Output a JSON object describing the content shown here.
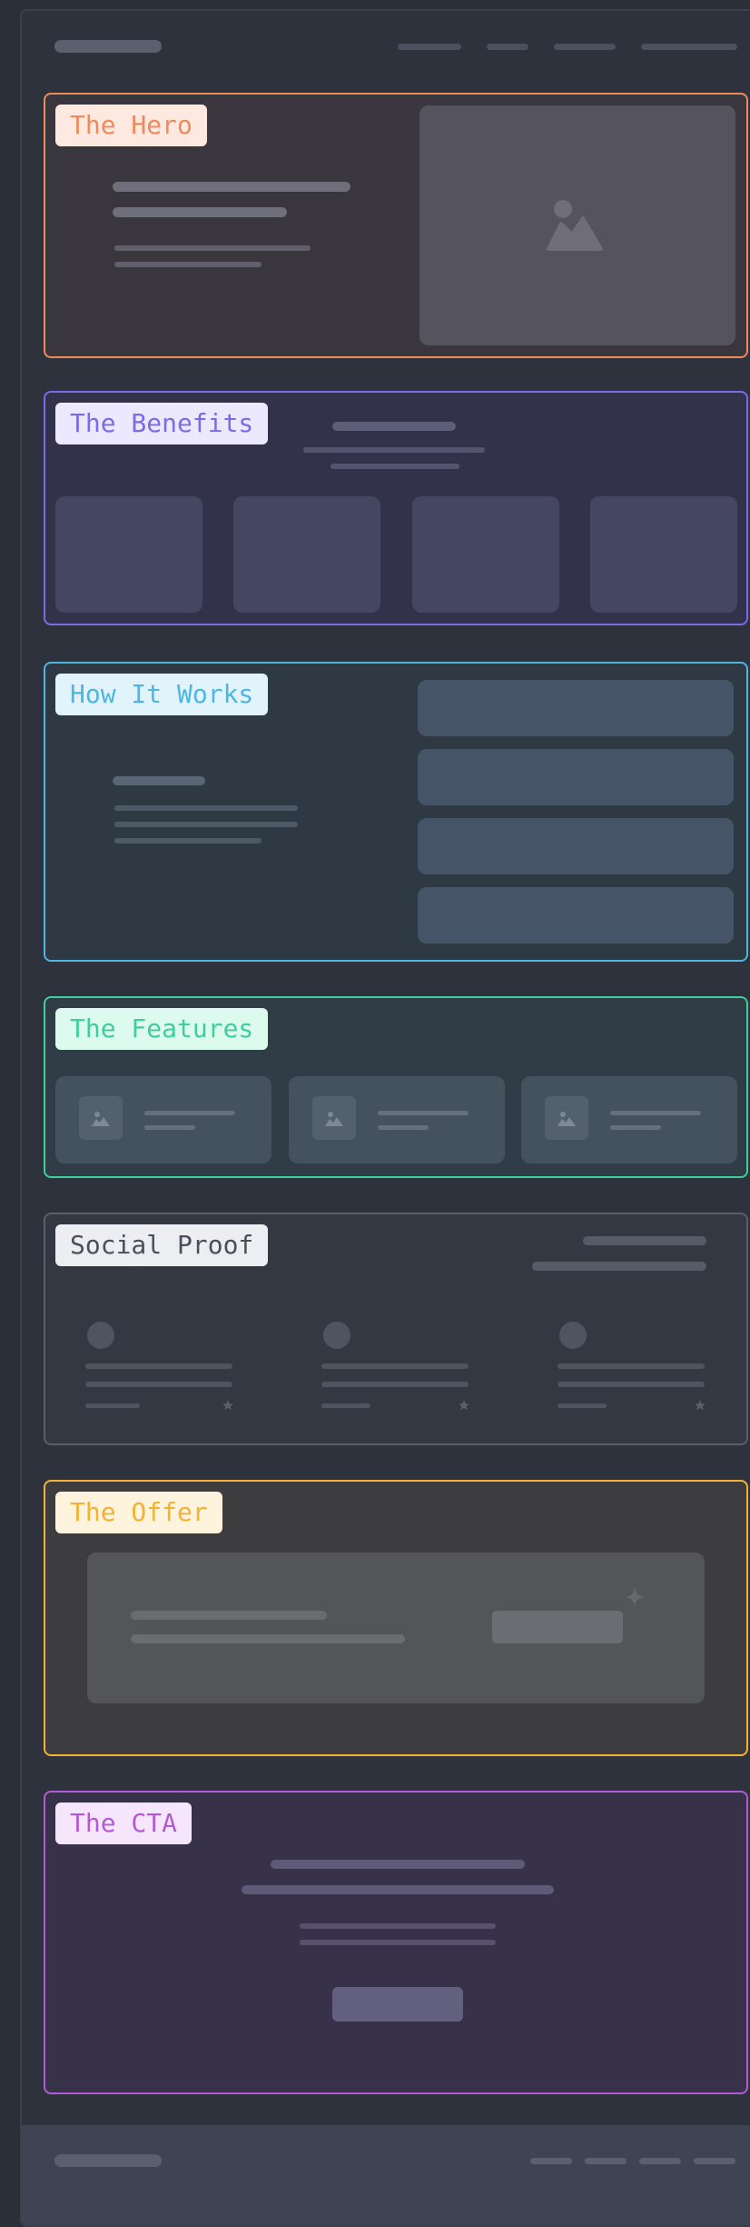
{
  "sections": {
    "hero": {
      "label": "The Hero",
      "color": "#f08a5d",
      "bg": "#3a363d"
    },
    "benefits": {
      "label": "The Benefits",
      "color": "#7c6ae6",
      "bg": "#32334a"
    },
    "how": {
      "label": "How It Works",
      "color": "#4eb6e0",
      "bg": "#2f3944"
    },
    "features": {
      "label": "The Features",
      "color": "#3ecf9a",
      "bg": "#303c46"
    },
    "social": {
      "label": "Social Proof",
      "color": "#5a5f6b",
      "bg": "#343843"
    },
    "offer": {
      "label": "The Offer",
      "color": "#f2b233",
      "bg": "#3d3d40"
    },
    "cta": {
      "label": "The CTA",
      "color": "#b45ad6",
      "bg": "#37324a"
    }
  },
  "icons": {
    "image": "image-placeholder-icon",
    "star": "star-icon",
    "sparkle": "sparkle-icon"
  }
}
